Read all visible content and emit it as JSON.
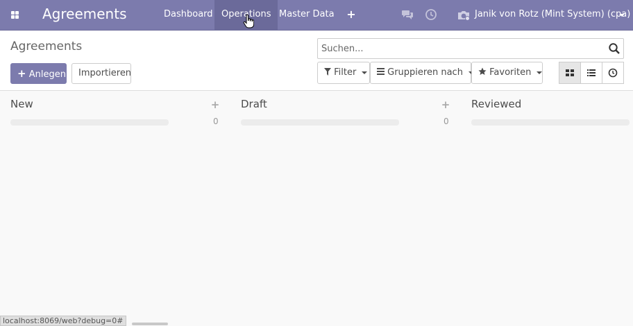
{
  "navbar": {
    "app_title": "Agreements",
    "menus": [
      "Dashboard",
      "Operations",
      "Master Data"
    ],
    "active_menu": "Operations",
    "user_label": "Janik von Rotz (Mint System) (cpa)"
  },
  "control_panel": {
    "title": "Agreements",
    "create_label": "Anlegen",
    "import_label": "Importieren",
    "search_placeholder": "Suchen...",
    "filter_label": "Filter",
    "group_by_label": "Gruppieren nach",
    "favorites_label": "Favoriten"
  },
  "kanban": {
    "columns": [
      {
        "name": "New",
        "count": "0"
      },
      {
        "name": "Draft",
        "count": "0"
      },
      {
        "name": "Reviewed"
      }
    ]
  },
  "status_bar": {
    "url": "localhost:8069/web?debug=0#"
  },
  "colors": {
    "brand": "#7c7bad",
    "brand_active": "#6b6a9a"
  },
  "icons": {
    "apps": "grid-icon",
    "quick_create": "plus-icon",
    "chat": "chat-icon",
    "activity": "clock-icon",
    "company": "camera-icon",
    "search": "search-icon",
    "filter": "filter-icon",
    "group_by": "bars-icon",
    "favorites": "star-icon",
    "kanban_view": "kanban-icon",
    "list_view": "list-icon",
    "activity_view": "clock-icon"
  }
}
